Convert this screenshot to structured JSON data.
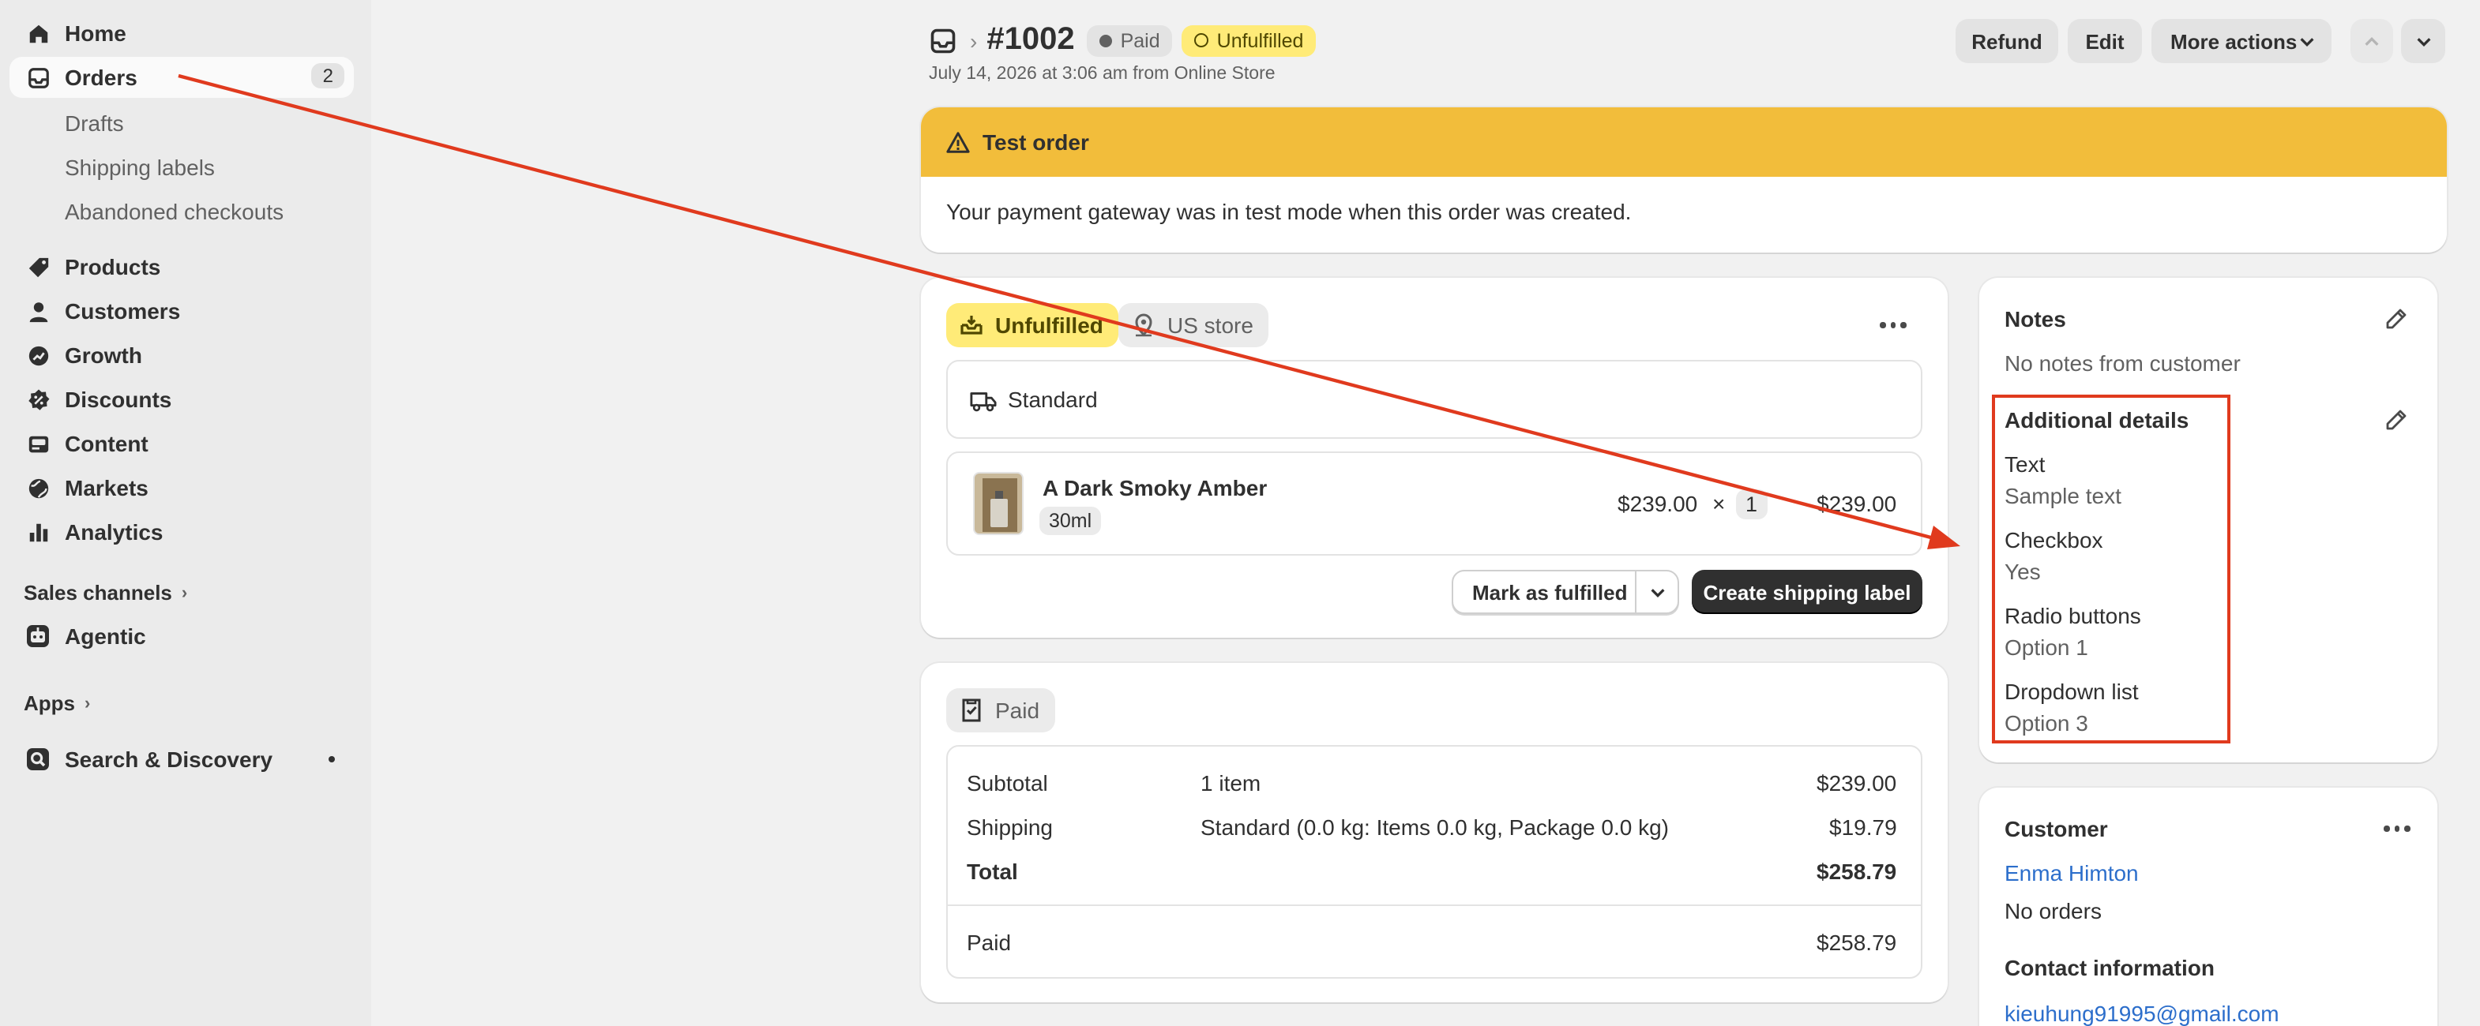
{
  "sidebar": {
    "items": [
      {
        "label": "Home",
        "icon": "home-icon"
      },
      {
        "label": "Orders",
        "icon": "inbox-icon",
        "count": "2"
      },
      {
        "label": "Products",
        "icon": "tag-icon"
      },
      {
        "label": "Customers",
        "icon": "person-icon"
      },
      {
        "label": "Growth",
        "icon": "growth-icon"
      },
      {
        "label": "Discounts",
        "icon": "discount-icon"
      },
      {
        "label": "Content",
        "icon": "content-icon"
      },
      {
        "label": "Markets",
        "icon": "globe-icon"
      },
      {
        "label": "Analytics",
        "icon": "bar-chart-icon"
      }
    ],
    "order_subitems": [
      "Drafts",
      "Shipping labels",
      "Abandoned checkouts"
    ],
    "sales_channels_label": "Sales channels",
    "agentic_label": "Agentic",
    "apps_label": "Apps",
    "search_discovery_label": "Search & Discovery"
  },
  "header": {
    "order_number": "#1002",
    "payment_status": "Paid",
    "fulfillment_status": "Unfulfilled",
    "subtitle": "July 14, 2026 at 3:06 am from Online Store",
    "refund_label": "Refund",
    "edit_label": "Edit",
    "more_actions_label": "More actions"
  },
  "test_banner": {
    "title": "Test order",
    "body": "Your payment gateway was in test mode when this order was created."
  },
  "fulfillment": {
    "status_label": "Unfulfilled",
    "location_label": "US store",
    "shipping_method": "Standard",
    "product": {
      "name": "A Dark Smoky Amber",
      "variant": "30ml",
      "unit_price": "$239.00",
      "times": "×",
      "quantity": "1",
      "total": "$239.00"
    },
    "mark_fulfilled_label": "Mark as fulfilled",
    "create_label_label": "Create shipping label"
  },
  "payment": {
    "status_label": "Paid",
    "rows": [
      {
        "label": "Subtotal",
        "detail": "1 item",
        "amount": "$239.00"
      },
      {
        "label": "Shipping",
        "detail": "Standard (0.0 kg: Items 0.0 kg, Package 0.0 kg)",
        "amount": "$19.79"
      },
      {
        "label": "Total",
        "detail": "",
        "amount": "$258.79"
      }
    ],
    "paid_label": "Paid",
    "paid_amount": "$258.79"
  },
  "notes": {
    "title": "Notes",
    "empty_text": "No notes from customer"
  },
  "additional_details": {
    "title": "Additional details",
    "fields": [
      {
        "label": "Text",
        "value": "Sample text"
      },
      {
        "label": "Checkbox",
        "value": "Yes"
      },
      {
        "label": "Radio buttons",
        "value": "Option 1"
      },
      {
        "label": "Dropdown list",
        "value": "Option 3"
      }
    ]
  },
  "customer": {
    "title": "Customer",
    "name": "Enma Himton",
    "orders_text": "No orders",
    "contact_title": "Contact information",
    "email": "kieuhung91995@gmail.com"
  },
  "colors": {
    "annotation_red": "#e03a1e",
    "banner_yellow": "#f2bd3b",
    "link_blue": "#2c6ecb",
    "status_yellow": "#ffeb78"
  }
}
